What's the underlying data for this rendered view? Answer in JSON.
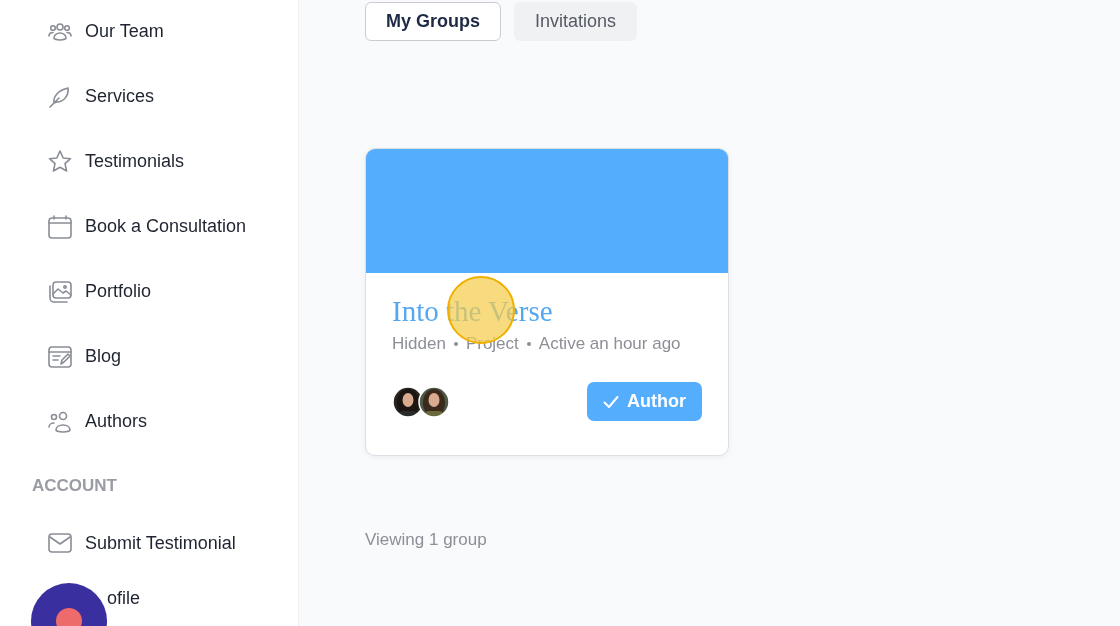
{
  "sidebar": {
    "items": [
      {
        "label": "Our Team",
        "kind": "team"
      },
      {
        "label": "Services",
        "kind": "feather"
      },
      {
        "label": "Testimonials",
        "kind": "star"
      },
      {
        "label": "Book a Consultation",
        "kind": "calendar"
      },
      {
        "label": "Portfolio",
        "kind": "images"
      },
      {
        "label": "Blog",
        "kind": "note"
      },
      {
        "label": "Authors",
        "kind": "users"
      }
    ],
    "section": "ACCOUNT",
    "account_items": [
      {
        "label": "Submit Testimonial",
        "kind": "mail"
      },
      {
        "label": "ofile"
      }
    ]
  },
  "tabs": [
    {
      "label": "My Groups",
      "selected": true
    },
    {
      "label": "Invitations",
      "selected": false
    }
  ],
  "groups": [
    {
      "title": "Into the Verse",
      "meta": [
        "Hidden",
        "Project",
        "Active an hour ago"
      ],
      "role": "Author"
    }
  ],
  "footer": "Viewing 1 group"
}
